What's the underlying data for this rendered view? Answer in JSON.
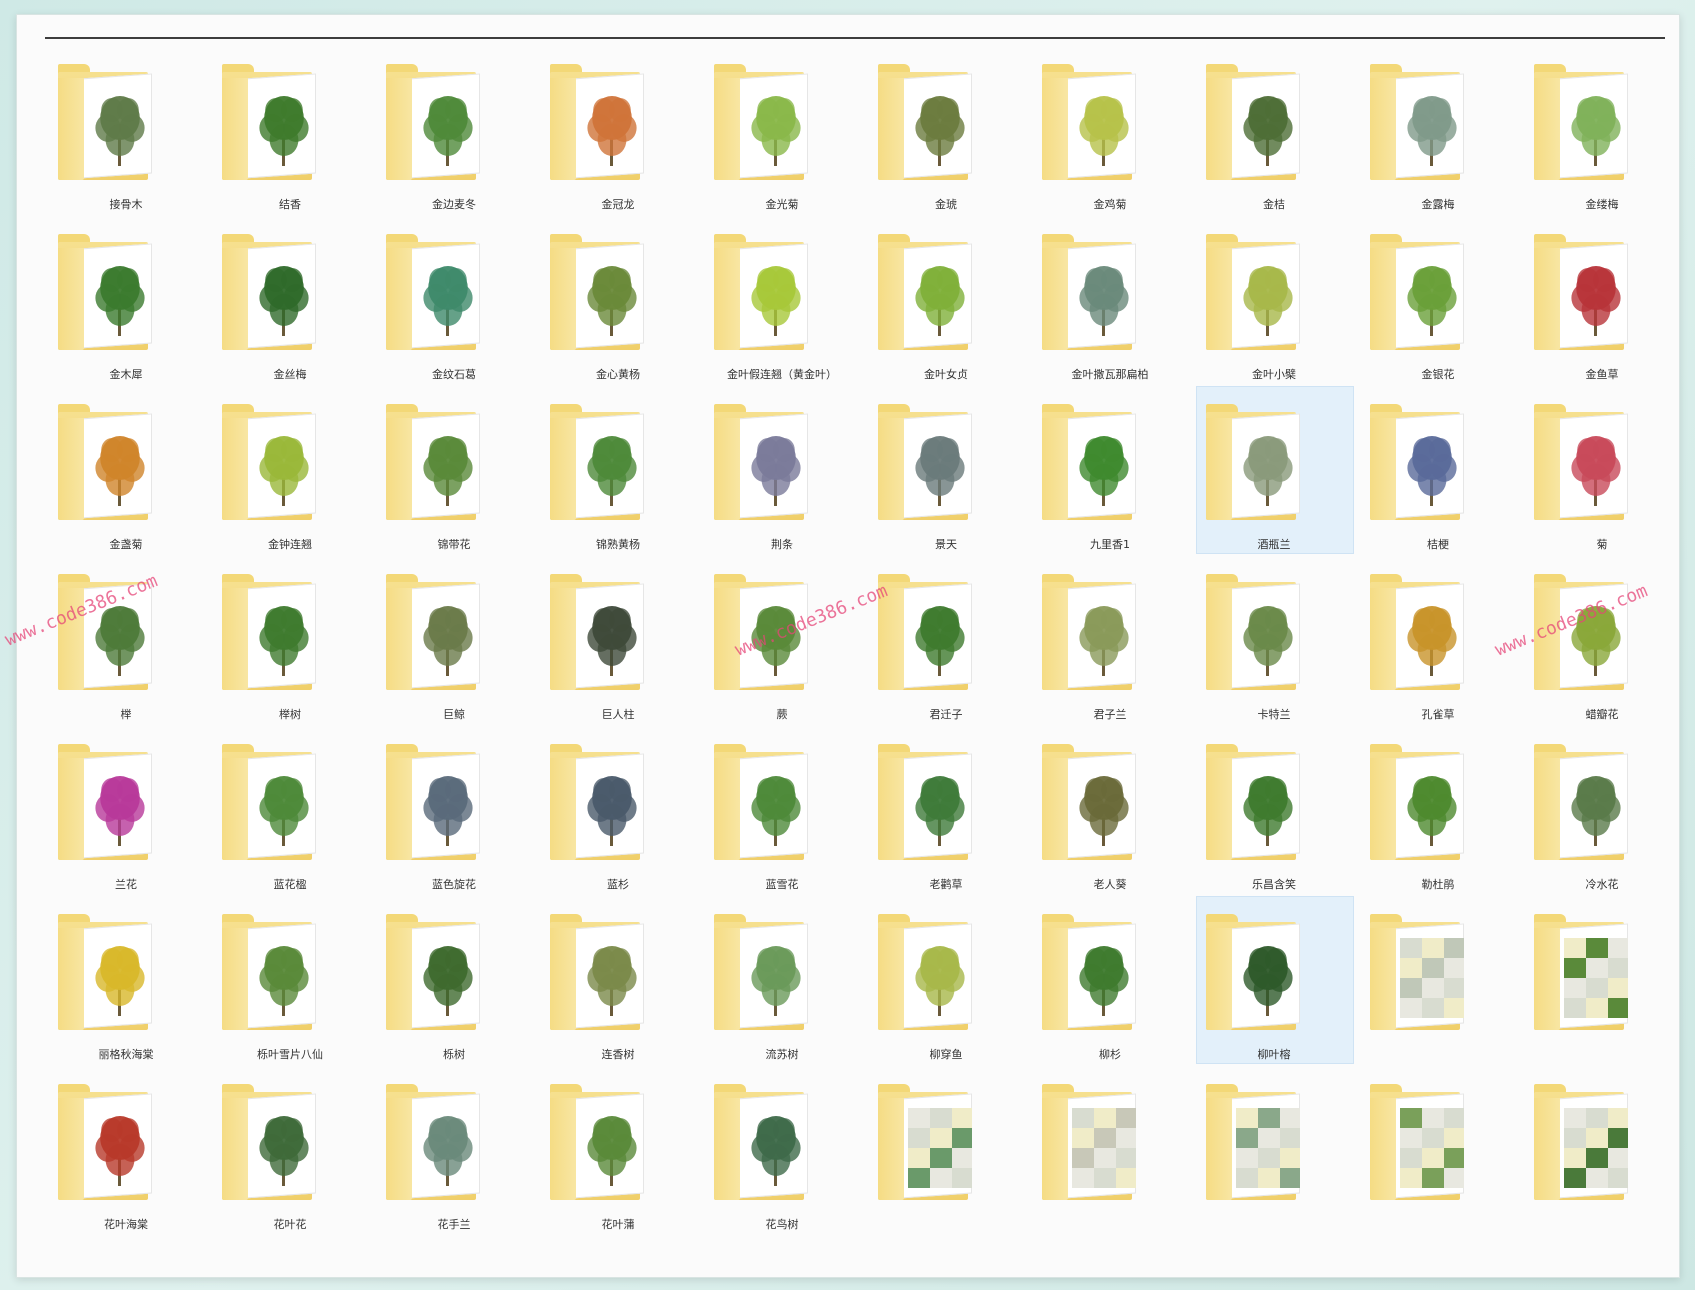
{
  "window": {
    "title": ""
  },
  "colors": {
    "folder": "#f0cf6a",
    "watermark": "#e64678",
    "selected": "#e3f0fa"
  },
  "items": [
    {
      "label": "接骨木",
      "color": "#5f7a48"
    },
    {
      "label": "结香",
      "color": "#3e7a2c"
    },
    {
      "label": "金边麦冬",
      "color": "#4f8a3a"
    },
    {
      "label": "金冠龙",
      "color": "#d0743a"
    },
    {
      "label": "金光菊",
      "color": "#8ab84a"
    },
    {
      "label": "金琥",
      "color": "#6b7c3e"
    },
    {
      "label": "金鸡菊",
      "color": "#b7c24a"
    },
    {
      "label": "金桔",
      "color": "#4e6e36"
    },
    {
      "label": "金露梅",
      "color": "#7f9a8a"
    },
    {
      "label": "金缕梅",
      "color": "#7fb25a"
    },
    {
      "label": "金木犀",
      "color": "#3b7a2e"
    },
    {
      "label": "金丝梅",
      "color": "#2f6a2a"
    },
    {
      "label": "金纹石葛",
      "color": "#3e8a6a"
    },
    {
      "label": "金心黄杨",
      "color": "#6a8a3a"
    },
    {
      "label": "金叶假连翘（黄金叶）",
      "color": "#a8c83a"
    },
    {
      "label": "金叶女贞",
      "color": "#7fb03a"
    },
    {
      "label": "金叶撒瓦那扁柏",
      "color": "#6a8a7a"
    },
    {
      "label": "金叶小檗",
      "color": "#a8b84a"
    },
    {
      "label": "金银花",
      "color": "#6aa03a"
    },
    {
      "label": "金鱼草",
      "color": "#b8343a"
    },
    {
      "label": "金盏菊",
      "color": "#d0842a"
    },
    {
      "label": "金钟连翘",
      "color": "#9ab83a"
    },
    {
      "label": "锦带花",
      "color": "#5a8a3a"
    },
    {
      "label": "锦熟黄杨",
      "color": "#4e8a3a"
    },
    {
      "label": "荆条",
      "color": "#7a7a9a"
    },
    {
      "label": "景天",
      "color": "#6a7a7a"
    },
    {
      "label": "九里香1",
      "color": "#3e8a2e"
    },
    {
      "label": "酒瓶兰",
      "color": "#8a9a7a",
      "selected": true
    },
    {
      "label": "桔梗",
      "color": "#5a6a9a"
    },
    {
      "label": "菊",
      "color": "#c84a5a"
    },
    {
      "label": "榉",
      "color": "#4e7a3a"
    },
    {
      "label": "榉树",
      "color": "#3e7a2e"
    },
    {
      "label": "巨鲸",
      "color": "#6a7a4a"
    },
    {
      "label": "巨人柱",
      "color": "#3e4a3a"
    },
    {
      "label": "蕨",
      "color": "#5a8a3a"
    },
    {
      "label": "君迁子",
      "color": "#3e7a2e"
    },
    {
      "label": "君子兰",
      "color": "#8a9a5a"
    },
    {
      "label": "卡特兰",
      "color": "#6a8a4a"
    },
    {
      "label": "孔雀草",
      "color": "#c8942a"
    },
    {
      "label": "蜡瓣花",
      "color": "#8aa83a"
    },
    {
      "label": "兰花",
      "color": "#b83a9a"
    },
    {
      "label": "蓝花楹",
      "color": "#4e8a3a"
    },
    {
      "label": "蓝色旋花",
      "color": "#5a6a7a"
    },
    {
      "label": "蓝杉",
      "color": "#4a5a6a"
    },
    {
      "label": "蓝雪花",
      "color": "#4e8a3a"
    },
    {
      "label": "老鹳草",
      "color": "#3e7a3a"
    },
    {
      "label": "老人葵",
      "color": "#6a6a3a"
    },
    {
      "label": "乐昌含笑",
      "color": "#3e7a2e"
    },
    {
      "label": "勒杜鹃",
      "color": "#4e8a2e"
    },
    {
      "label": "冷水花",
      "color": "#5a7a4a"
    },
    {
      "label": "丽格秋海棠",
      "color": "#d8b82a"
    },
    {
      "label": "栎叶雪片八仙",
      "color": "#5a8a3a"
    },
    {
      "label": "栎树",
      "color": "#3e6a2e"
    },
    {
      "label": "连香树",
      "color": "#7a8a4a"
    },
    {
      "label": "流苏树",
      "color": "#6a9a5a"
    },
    {
      "label": "柳穿鱼",
      "color": "#a8b84a"
    },
    {
      "label": "柳杉",
      "color": "#3e7a2e"
    },
    {
      "label": "柳叶榕",
      "color": "#2e5a2a",
      "selected": true
    },
    {
      "label": "",
      "color": "#c0c8b8",
      "blurred": true
    },
    {
      "label": "",
      "color": "#5a8a3a",
      "blurred": true
    },
    {
      "label": "花叶海棠",
      "color": "#b83a2a"
    },
    {
      "label": "花叶花",
      "color": "#3e6a3a"
    },
    {
      "label": "花手兰",
      "color": "#6a8a7a"
    },
    {
      "label": "花叶蒲",
      "color": "#5a8a3a"
    },
    {
      "label": "花鸟树",
      "color": "#3e6a4a"
    },
    {
      "label": "",
      "color": "#6a9a6a",
      "blurred": true
    },
    {
      "label": "",
      "color": "#c8c8b8",
      "blurred": true
    },
    {
      "label": "",
      "color": "#8aa88a",
      "blurred": true
    },
    {
      "label": "",
      "color": "#7aa05a",
      "blurred": true
    },
    {
      "label": "",
      "color": "#4a7a3a",
      "blurred": true
    }
  ],
  "watermarks": [
    {
      "text": "www.code386.com"
    },
    {
      "text": "www.code386.com"
    },
    {
      "text": "www.code386.com"
    }
  ]
}
